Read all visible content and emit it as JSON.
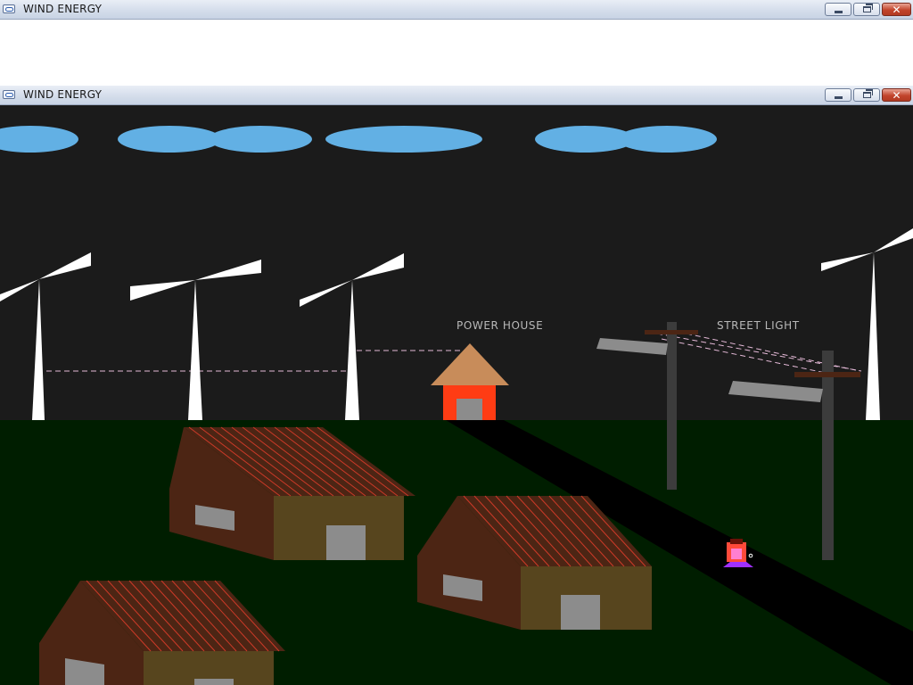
{
  "back_window": {
    "title": "WIND ENERGY",
    "controls": {
      "minimize": "minimize",
      "maximize": "restore",
      "close": "✕"
    }
  },
  "front_window": {
    "title": "WIND ENERGY",
    "controls": {
      "minimize": "minimize",
      "maximize": "restore",
      "close": "✕"
    }
  },
  "scene": {
    "labels": {
      "power_house": "POWER HOUSE",
      "street_light": "STREET LIGHT"
    },
    "colors": {
      "sky": "#1b1b1b",
      "ground": "#001e00",
      "cloud": "#62b0e4",
      "turbine": "#ffffff",
      "road": "#000000",
      "power_house_wall": "#ff3c14",
      "power_house_roof": "#c88c5a",
      "house_front": "#57451e",
      "house_side": "#4c2514",
      "roof_stripes": "#cc3a28",
      "pole": "#3c3c3c",
      "lamp_head": "#8c8c8c",
      "wire": "#e3b8d6",
      "figure_body": "#ff4a3a",
      "figure_base": "#9f30ff"
    },
    "icons": [
      "turbine-icon",
      "cloud-icon",
      "house-icon",
      "street-light-icon",
      "person-icon"
    ]
  }
}
